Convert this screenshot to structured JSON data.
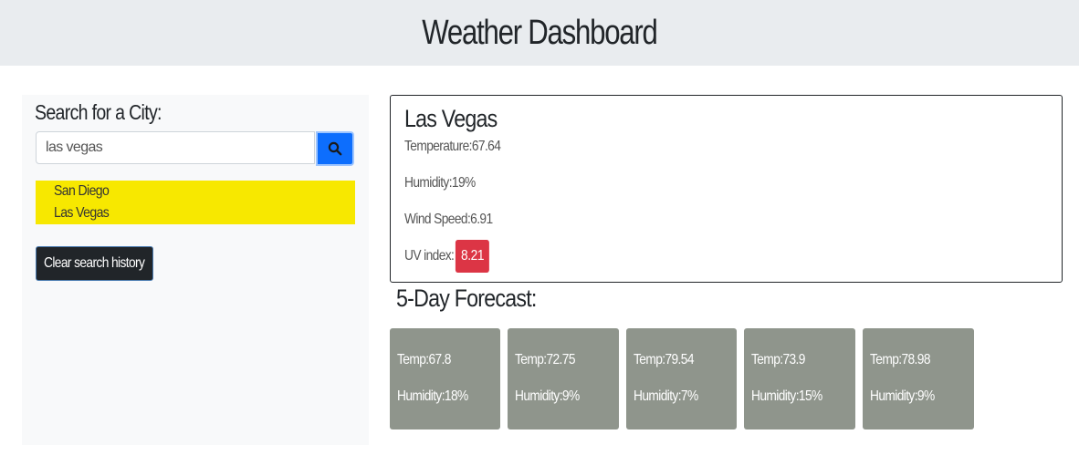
{
  "header": {
    "title": "Weather Dashboard"
  },
  "sidebar": {
    "title": "Search for a City:",
    "search": {
      "value": "las vegas",
      "placeholder": ""
    },
    "search_button_icon": "search-icon",
    "history": [
      "San Diego",
      "Las Vegas"
    ],
    "clear_label": "Clear search history"
  },
  "current": {
    "city": "Las Vegas",
    "temperature": "Temperature:67.64",
    "humidity": "Humidity:19%",
    "wind": "Wind Speed:6.91",
    "uv_label": "UV index:",
    "uv_value": "8.21"
  },
  "forecast": {
    "title": "5-Day Forecast:",
    "days": [
      {
        "temp": "Temp:67.8",
        "humidity": "Humidity:18%"
      },
      {
        "temp": "Temp:72.75",
        "humidity": "Humidity:9%"
      },
      {
        "temp": "Temp:79.54",
        "humidity": "Humidity:7%"
      },
      {
        "temp": "Temp:73.9",
        "humidity": "Humidity:15%"
      },
      {
        "temp": "Temp:78.98",
        "humidity": "Humidity:9%"
      }
    ]
  },
  "colors": {
    "header_bg": "#e9ecef",
    "sidebar_bg": "#f8f9fa",
    "history_bg": "#f7e800",
    "search_button": "#0d6efd",
    "uv_badge": "#dc3545",
    "forecast_card": "#8f958c",
    "clear_button": "#212529"
  }
}
